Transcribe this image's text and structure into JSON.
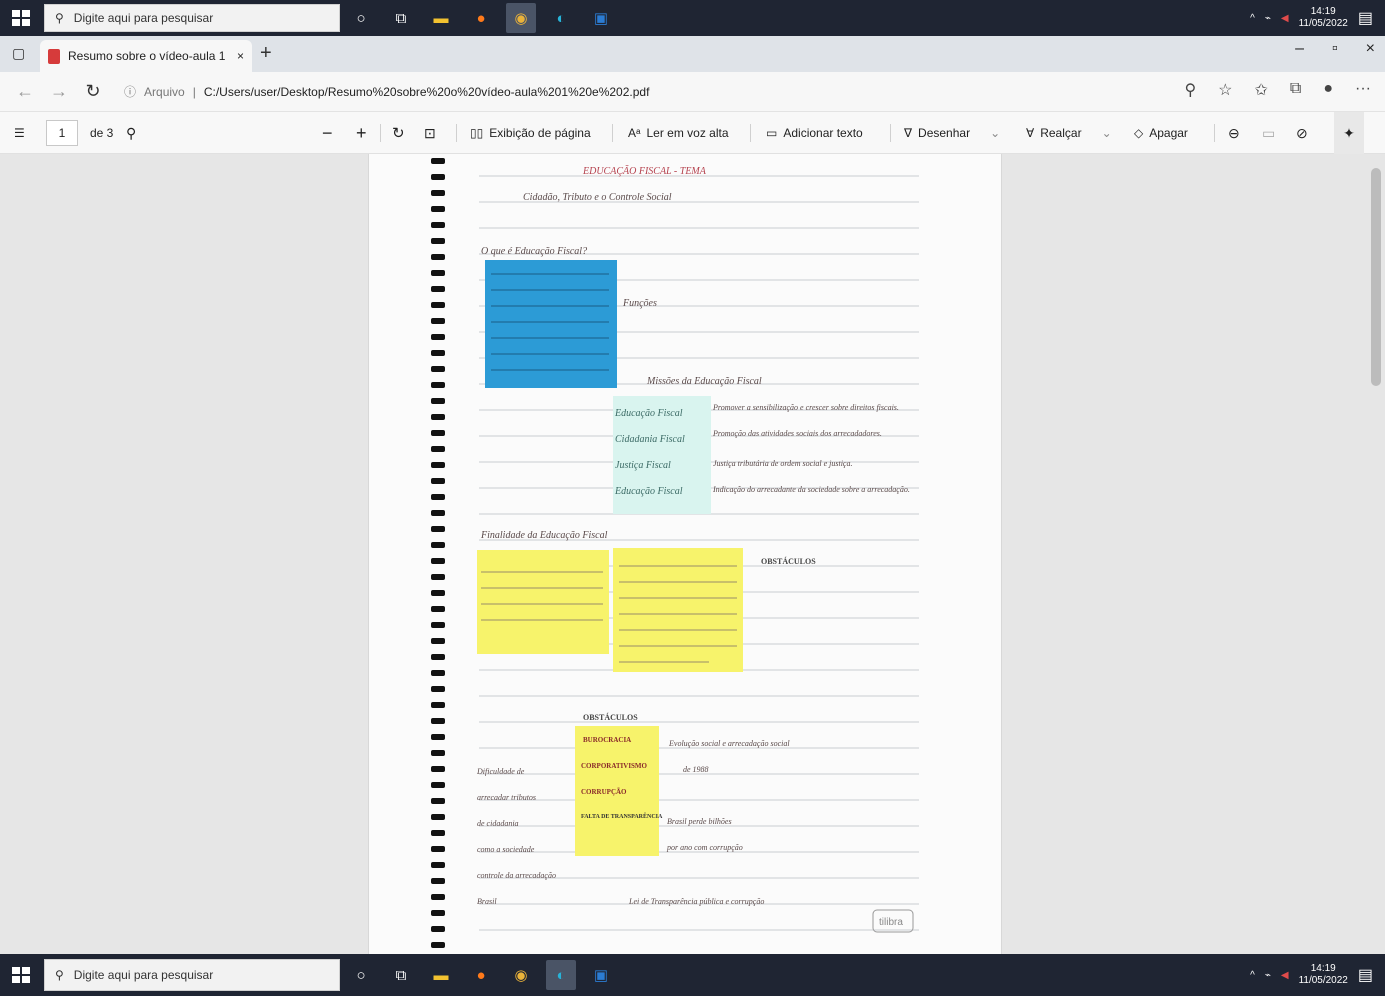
{
  "top_taskbar": {
    "search_placeholder": "Digite aqui para pesquisar",
    "icons": [
      "cortana-icon",
      "task-view-icon",
      "file-explorer-icon",
      "firefox-icon",
      "chrome-icon",
      "edge-icon",
      "outlook-icon"
    ],
    "clock_time": "14:19",
    "clock_date": "11/05/2022"
  },
  "browser": {
    "tab_title": "Resumo sobre o vídeo-aula 1 e 2",
    "url_label": "Arquivo",
    "url": "C:/Users/user/Desktop/Resumo%20sobre%20o%20vídeo-aula%201%20e%202.pdf"
  },
  "pdf_toolbar": {
    "page_number": "1",
    "page_count": "de 3",
    "page_view": "Exibição de página",
    "read_aloud": "Ler em voz alta",
    "add_text": "Adicionar texto",
    "draw": "Desenhar",
    "highlight": "Realçar",
    "erase": "Apagar"
  },
  "notes": {
    "title": "EDUCAÇÃO FISCAL - TEMA",
    "subtitle": "Cidadão, Tributo e o Controle Social",
    "q1": "O que é Educação Fiscal?",
    "funcoes": "Funções",
    "missoes": "Missões da Educação Fiscal",
    "green_items": [
      "Educação Fiscal",
      "Cidadania Fiscal",
      "Justiça Fiscal",
      "Educação Fiscal"
    ],
    "right_notes": [
      "Promover a sensibilização e crescer sobre direitos fiscais.",
      "Promoção das atividades sociais dos arrecadadores.",
      "Justiça tributária de ordem social e justiça.",
      "Indicação do arrecadante da sociedade sobre a arrecadação."
    ],
    "finalidade": "Finalidade da Educação Fiscal",
    "yellow_left": "Conscientização sobre a sociedade com a atuação das instituições públicas e participação social.",
    "yellow_right": "O papel cidadão da população na arrecadação, fiscalização e transparência dos recursos públicos para o cumprimento das funções do Estado.",
    "obstaculos_top": "OBSTÁCULOS",
    "obstaculos_mid": "OBSTÁCULOS",
    "obst_list": [
      "BUROCRACIA",
      "CORPORATIVISMO",
      "CORRUPÇÃO",
      "FALTA DE TRANSPARÊNCIA"
    ],
    "left_notes": [
      "Dificuldade de",
      "arrecadar tributos",
      "de cidadania",
      "como a sociedade",
      "controle da arrecadação",
      "Brasil"
    ],
    "right_notes_2": [
      "Evolução social e arrecadação social",
      "de 1988",
      "Brasil perde bilhões",
      "por ano com corrupção",
      "Lei de Transparência pública e corrupção"
    ],
    "stamp": "tilibra"
  },
  "bottom_taskbar": {
    "search_placeholder": "Digite aqui para pesquisar",
    "clock_time": "14:19",
    "clock_date": "11/05/2022"
  }
}
